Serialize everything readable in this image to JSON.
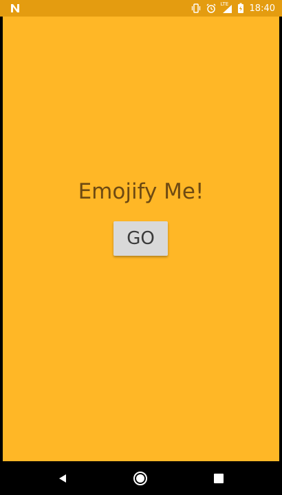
{
  "status_bar": {
    "time": "18:40",
    "network_label": "LTE",
    "notification_icon": "n-icon",
    "background_color": "#E49C10"
  },
  "app": {
    "background_color": "#FFB726",
    "title": "Emojify Me!",
    "go_button_label": "GO"
  },
  "nav_bar": {
    "back_icon": "back-icon",
    "home_icon": "home-icon",
    "recents_icon": "recents-icon"
  }
}
